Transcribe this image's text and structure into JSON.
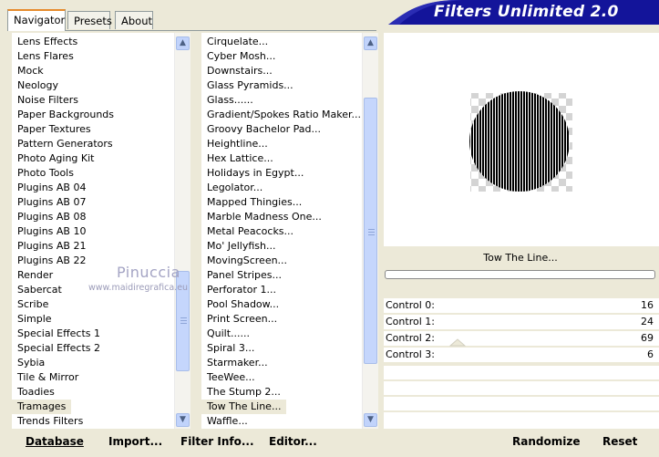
{
  "banner": {
    "title": "Filters Unlimited 2.0"
  },
  "tabs": [
    {
      "label": "Navigator",
      "active": true
    },
    {
      "label": "Presets",
      "active": false
    },
    {
      "label": "About",
      "active": false
    }
  ],
  "categories": {
    "items": [
      "Lens Effects",
      "Lens Flares",
      "Mock",
      "Neology",
      "Noise Filters",
      "Paper Backgrounds",
      "Paper Textures",
      "Pattern Generators",
      "Photo Aging Kit",
      "Photo Tools",
      "Plugins AB 04",
      "Plugins AB 07",
      "Plugins AB 08",
      "Plugins AB 10",
      "Plugins AB 21",
      "Plugins AB 22",
      "Render",
      "Sabercat",
      "Scribe",
      "Simple",
      "Special Effects 1",
      "Special Effects 2",
      "Sybia",
      "Tile & Mirror",
      "Toadies",
      "Tramages",
      "Trends Filters"
    ],
    "selected": "Tramages",
    "scroll_position_fraction": 0.85
  },
  "filters": {
    "items": [
      "Cirquelate...",
      "Cyber Mosh...",
      "Downstairs...",
      "Glass Pyramids...",
      "Glass......",
      "Gradient/Spokes Ratio Maker...",
      "Groovy Bachelor Pad...",
      "Heightline...",
      "Hex Lattice...",
      "Holidays in Egypt...",
      "Legolator...",
      "Mapped Thingies...",
      "Marble Madness One...",
      "Metal Peacocks...",
      "Mo' Jellyfish...",
      "MovingScreen...",
      "Panel Stripes...",
      "Perforator 1...",
      "Pool Shadow...",
      "Print Screen...",
      "Quilt......",
      "Spiral 3...",
      "Starmaker...",
      "TeeWee...",
      "The Stump 2...",
      "Tow The Line...",
      "Waffle..."
    ],
    "selected": "Tow The Line...",
    "scroll_position_fraction": 0.5
  },
  "watermark": {
    "name": "Pinuccia",
    "site": "www.maidiregrafica.eu"
  },
  "preview": {
    "filter_name": "Tow The Line..."
  },
  "controls": [
    {
      "label": "Control 0:",
      "value": "16"
    },
    {
      "label": "Control 1:",
      "value": "24"
    },
    {
      "label": "Control 2:",
      "value": "69"
    },
    {
      "label": "Control 3:",
      "value": "6"
    }
  ],
  "buttons": {
    "database": "Database",
    "import": "Import...",
    "filter_info": "Filter Info...",
    "editor": "Editor...",
    "randomize": "Randomize",
    "reset": "Reset"
  },
  "colors": {
    "banner": "#13149a",
    "selection": "#ece9d8",
    "scroll_thumb": "#c5d6fc"
  }
}
